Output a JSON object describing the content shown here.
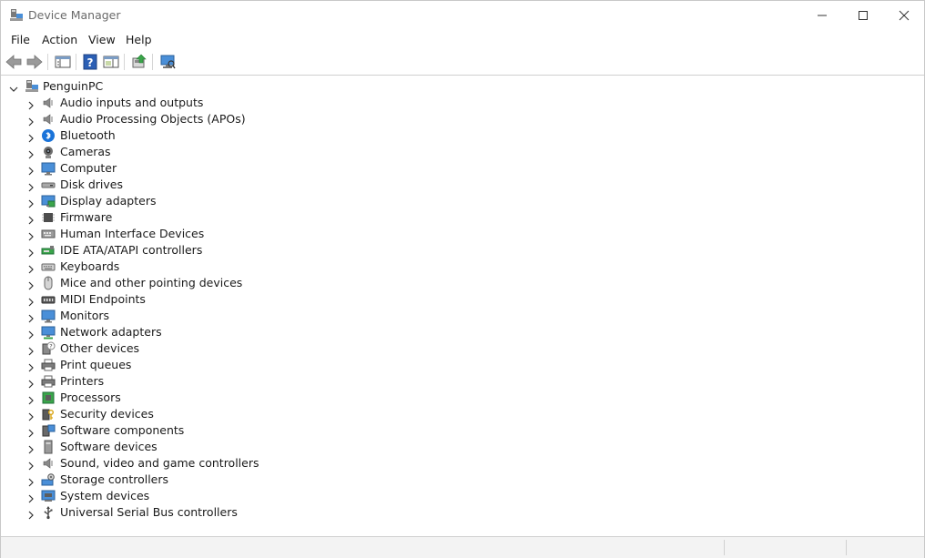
{
  "window": {
    "title": "Device Manager"
  },
  "menu": [
    {
      "label": "File"
    },
    {
      "label": "Action"
    },
    {
      "label": "View"
    },
    {
      "label": "Help"
    }
  ],
  "toolbar": {
    "buttons": [
      "back-icon",
      "forward-icon",
      "show-hide-console-tree-icon",
      "help-icon",
      "action-pane-icon",
      "update-driver-icon",
      "scan-hardware-icon"
    ]
  },
  "tree": {
    "root": {
      "label": "PenguinPC",
      "icon": "computer-root-icon"
    },
    "items": [
      {
        "label": "Audio inputs and outputs",
        "icon": "speaker-icon"
      },
      {
        "label": "Audio Processing Objects (APOs)",
        "icon": "speaker-icon"
      },
      {
        "label": "Bluetooth",
        "icon": "bluetooth-icon"
      },
      {
        "label": "Cameras",
        "icon": "camera-icon"
      },
      {
        "label": "Computer",
        "icon": "monitor-icon"
      },
      {
        "label": "Disk drives",
        "icon": "disk-drive-icon"
      },
      {
        "label": "Display adapters",
        "icon": "display-adapter-icon"
      },
      {
        "label": "Firmware",
        "icon": "chip-icon"
      },
      {
        "label": "Human Interface Devices",
        "icon": "hid-icon"
      },
      {
        "label": "IDE ATA/ATAPI controllers",
        "icon": "ide-controller-icon"
      },
      {
        "label": "Keyboards",
        "icon": "keyboard-icon"
      },
      {
        "label": "Mice and other pointing devices",
        "icon": "mouse-icon"
      },
      {
        "label": "MIDI Endpoints",
        "icon": "midi-icon"
      },
      {
        "label": "Monitors",
        "icon": "monitor-icon"
      },
      {
        "label": "Network adapters",
        "icon": "network-adapter-icon"
      },
      {
        "label": "Other devices",
        "icon": "unknown-device-icon"
      },
      {
        "label": "Print queues",
        "icon": "printer-icon"
      },
      {
        "label": "Printers",
        "icon": "printer-icon"
      },
      {
        "label": "Processors",
        "icon": "processor-icon"
      },
      {
        "label": "Security devices",
        "icon": "security-device-icon"
      },
      {
        "label": "Software components",
        "icon": "software-component-icon"
      },
      {
        "label": "Software devices",
        "icon": "software-device-icon"
      },
      {
        "label": "Sound, video and game controllers",
        "icon": "speaker-icon"
      },
      {
        "label": "Storage controllers",
        "icon": "storage-controller-icon"
      },
      {
        "label": "System devices",
        "icon": "system-device-icon"
      },
      {
        "label": "Universal Serial Bus controllers",
        "icon": "usb-icon"
      }
    ]
  },
  "colors": {
    "accent": "#0067c0",
    "bluetooth": "#1a73d9",
    "text": "#1a1a1a"
  }
}
